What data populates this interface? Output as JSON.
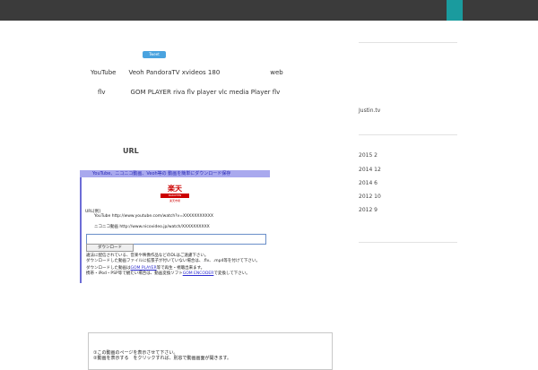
{
  "tweet_button": "Tweet",
  "intro": {
    "line1": "YouTube　　Veoh PandoraTV xvideos  180　　　　　　　　web",
    "line2": "flv　　　　GOM PLAYER riva flv player vlc media Player  flv"
  },
  "section_heading": "URL",
  "embed": {
    "title": "YouTube、ニコニコ動画、Veoh等の 動画を簡単にダウンロード保存",
    "logo_main": "楽天",
    "logo_strip": "RAKUTEN",
    "logo_small": "楽天市場",
    "url_example_label": "URL[例]",
    "youtube_example": "YouTube http://www.youtube.com/watch?v=XXXXXXXXXXX",
    "nico_example": "ニコニコ動画  http://www.nicovideo.jp/watch/XXXXXXXXXX",
    "input_value": "",
    "download_button": "ダウンロード",
    "note1": "違法に配信されている、音楽や映像作品などのDLはご遠慮下さい。",
    "note2": "ダウンロードした動画ファイルに拡張子が付いていない場合は、.flv、.mp4等を付けて下さい。",
    "note3_prefix": "ダウンロードした動画は",
    "note3_link": "GOM PLAYER",
    "note3_suffix": "等で再生・視聴出来ます。",
    "note4_prefix": "携帯・iPod・PSP等で観たい場合は、動画変換ソフト",
    "note4_link": "GOM ENCODER",
    "note4_suffix": "で変換して下さい。"
  },
  "bottom_box": {
    "line1": "①この動画のページを表示させて下さい。",
    "line2": "②動画を表示する　をクリックすれば、別窓で動画画面が開きます。"
  },
  "sidebar": {
    "justin": "Justin.tv",
    "archives": [
      "2015 2",
      "2014 12",
      "2014 6",
      "2012 10",
      "2012 9"
    ]
  }
}
